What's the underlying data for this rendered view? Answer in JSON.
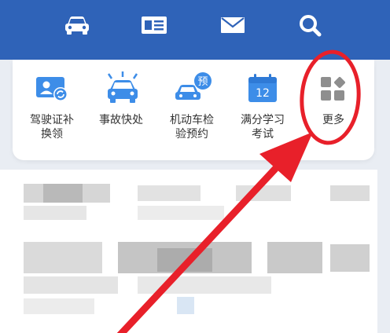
{
  "top_bar": {
    "icons": [
      "car-icon",
      "id-card-icon",
      "mail-icon",
      "search-icon"
    ]
  },
  "menu": {
    "items": [
      {
        "label": "驾驶证补\n换领",
        "icon": "license-renew-icon"
      },
      {
        "label": "事故快处",
        "icon": "accident-icon"
      },
      {
        "label": "机动车检\n验预约",
        "icon": "vehicle-inspection-icon"
      },
      {
        "label": "满分学习\n考试",
        "icon": "study-exam-icon"
      },
      {
        "label": "更多",
        "icon": "more-icon"
      }
    ],
    "badge_预": "预",
    "badge_12": "12"
  },
  "colors": {
    "header": "#2f63b8",
    "accent_blue": "#3d8de8",
    "annotation_red": "#e8202a"
  }
}
